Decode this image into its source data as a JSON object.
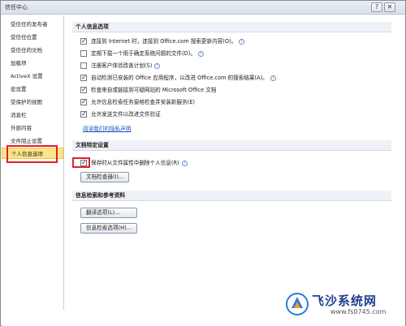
{
  "window": {
    "title": "信任中心",
    "help": "?",
    "close": "✕"
  },
  "sidebar": {
    "items": [
      {
        "label": "受信任的发布者"
      },
      {
        "label": "受信任位置"
      },
      {
        "label": "受信任的文档"
      },
      {
        "label": "加载项"
      },
      {
        "label": "ActiveX 设置"
      },
      {
        "label": "宏设置"
      },
      {
        "label": "受保护的视图"
      },
      {
        "label": "消息栏"
      },
      {
        "label": "外部内容"
      },
      {
        "label": "文件阻止设置"
      },
      {
        "label": "个人信息选项"
      }
    ],
    "selected_index": 10
  },
  "privacy": {
    "header": "个人信息选项",
    "options": [
      {
        "label": "连接到 Internet 时，连接到 Office.com 搜索更新内容(O)。",
        "checked": true,
        "info": true
      },
      {
        "label": "定期下载一个用于确定系统问题的文件(D)。",
        "checked": false,
        "info": true
      },
      {
        "label": "注册客户体验改善计划(S)",
        "checked": false,
        "info": true
      },
      {
        "label": "自动检测已安装的 Office 应用程序，以改进 Office.com 的搜索结果(A)。",
        "checked": true,
        "info": true
      },
      {
        "label": "检查来自或链接到可疑网站的 Microsoft Office 文档",
        "checked": true,
        "info": false
      },
      {
        "label": "允许信息检索任务窗格检查并安装新服务(E)",
        "checked": true,
        "info": false
      },
      {
        "label": "允许发送文件以改进文件验证",
        "checked": true,
        "info": false
      }
    ],
    "link": "阅读我们的隐私声明"
  },
  "document": {
    "header": "文档特定设置",
    "option": {
      "label": "保存时从文件属性中删除个人信息(R)",
      "checked": true,
      "info": true
    },
    "inspector_button": "文档检查器(I)..."
  },
  "research": {
    "header": "信息检索和参考资料",
    "translate_button": "翻译选项(L)...",
    "research_button": "信息检索选项(H)..."
  },
  "watermark": {
    "title": "飞沙系统网",
    "url": "www.fs0745.com"
  },
  "colors": {
    "selected_bg": "#fde48b",
    "highlight_box": "#e0202a",
    "link": "#1f4fbf"
  }
}
